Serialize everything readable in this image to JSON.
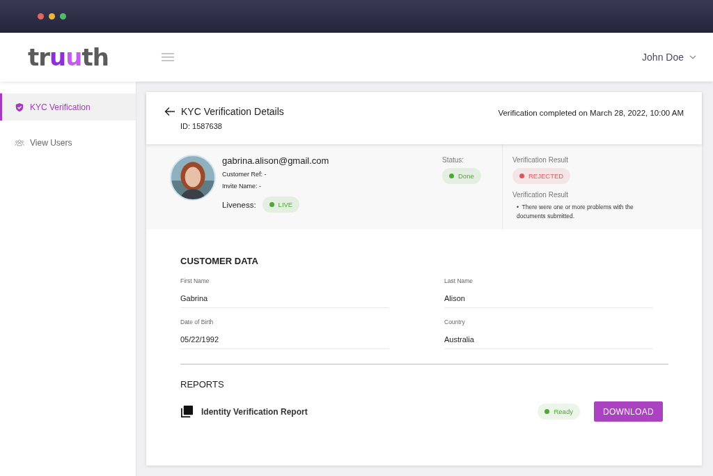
{
  "logo": [
    {
      "text": "tr",
      "color": "#5b5b5b"
    },
    {
      "text": "u",
      "color": "#8e2fd8"
    },
    {
      "text": "u",
      "color": "#c45cf0"
    },
    {
      "text": "th",
      "color": "#5b5b5b"
    }
  ],
  "user": {
    "name": "John Doe"
  },
  "sidebar": {
    "items": [
      {
        "label": "KYC Verification",
        "kind": "shield",
        "selected": true
      },
      {
        "label": "View Users",
        "kind": "users",
        "selected": false
      }
    ]
  },
  "details": {
    "title": "KYC Verification Details",
    "id": "ID: 1587638",
    "completed": "Verification completed on March 28, 2022, 10:00 AM",
    "email": "gabrina.alison@gmail.com",
    "customer_ref": "Customer Ref: -",
    "invite_name": "Invite Name: -",
    "liveness": {
      "label": "Liveness:",
      "chip": {
        "text": "LIVE",
        "color": "#4caa34"
      }
    },
    "status": {
      "label": "Status:",
      "chip": {
        "text": "Done",
        "color": "#4caa34"
      }
    },
    "result": {
      "label": "Verification Result",
      "chip": {
        "text": "REJECTED",
        "color": "#d9595a"
      }
    },
    "result_notes": {
      "label": "Verification Result",
      "items": [
        "•  There were one or more problems with the documents submitted."
      ]
    }
  },
  "customer_data": {
    "title": "CUSTOMER DATA",
    "fields": [
      {
        "label": "First Name",
        "value": "Gabrina"
      },
      {
        "label": "Last Name",
        "value": "Alison"
      },
      {
        "label": "Date of Birth",
        "value": "05/22/1992"
      },
      {
        "label": "Country",
        "value": "Australia"
      }
    ]
  },
  "reports": {
    "title": "REPORTS",
    "items": [
      {
        "name": "Identity Verification Report",
        "chip": {
          "text": "Ready",
          "color": "#4caa34"
        },
        "button": "DOWNLOAD"
      }
    ]
  }
}
